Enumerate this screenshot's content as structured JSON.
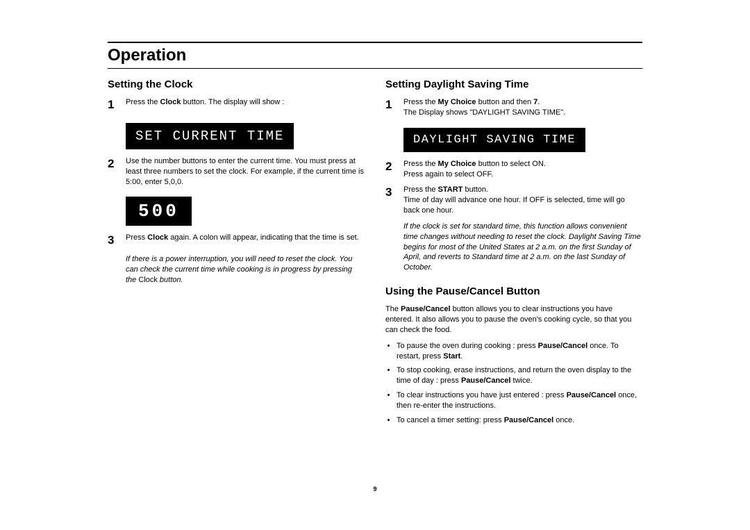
{
  "title": "Operation",
  "pageNumber": "9",
  "left": {
    "heading": "Setting the Clock",
    "step1_num": "1",
    "step1_a": "Press the ",
    "step1_b": "Clock",
    "step1_c": " button. The display will show :",
    "display1": "SET CURRENT TIME",
    "step2_num": "2",
    "step2": "Use the number buttons to enter the current time. You must press at least three numbers to set the clock. For example, if the current time is 5:00, enter 5,0,0.",
    "display2": "500",
    "step3_num": "3",
    "step3_a": "Press ",
    "step3_b": "Clock",
    "step3_c": " again. A colon will appear, indicating that the time is set.",
    "note_a": "If there is a power interruption, you will need to reset the clock. You can check the current time while cooking is in progress by pressing the ",
    "note_b": "Clock",
    "note_c": "  button."
  },
  "right": {
    "heading1": "Setting Daylight Saving Time",
    "d1_num": "1",
    "d1_a": "Press the ",
    "d1_b": "My Choice",
    "d1_c": " button and then ",
    "d1_d": "7",
    "d1_e": ".",
    "d1_line2": "The Display shows \"DAYLIGHT SAVING TIME\".",
    "display1": "DAYLIGHT SAVING TIME",
    "d2_num": "2",
    "d2_a": "Press the ",
    "d2_b": "My Choice",
    "d2_c": " button to select ON.",
    "d2_line2": "Press again to select OFF.",
    "d3_num": "3",
    "d3_a": "Press the ",
    "d3_b": "START",
    "d3_c": " button.",
    "d3_line2": "Time of day will advance one hour. If OFF is selected, time will go back one hour.",
    "note": "If the clock is set for standard time, this function  allows convenient time changes without needing to reset the clock. Daylight Saving Time begins for most of the United States at 2 a.m. on the first Sunday of April, and reverts to Standard time at 2 a.m. on the last Sunday of October.",
    "heading2": "Using the Pause/Cancel Button",
    "intro_a": "The ",
    "intro_b": "Pause/Cancel",
    "intro_c": " button allows you to clear instructions you have entered. It also allows you to pause the oven's cooking cycle, so that you can check the food.",
    "b1_a": "To pause the oven during cooking : press ",
    "b1_b": "Pause/Cancel",
    "b1_c": " once. To restart, press ",
    "b1_d": "Start",
    "b1_e": ".",
    "b2_a": "To stop cooking, erase instructions, and return the oven display to the time of day : press ",
    "b2_b": "Pause/Cancel",
    "b2_c": " twice.",
    "b3_a": "To clear instructions you have just entered : press ",
    "b3_b": "Pause/Cancel",
    "b3_c": " once, then re-enter the instructions.",
    "b4_a": "To cancel a timer setting: press ",
    "b4_b": "Pause/Cancel",
    "b4_c": " once."
  }
}
